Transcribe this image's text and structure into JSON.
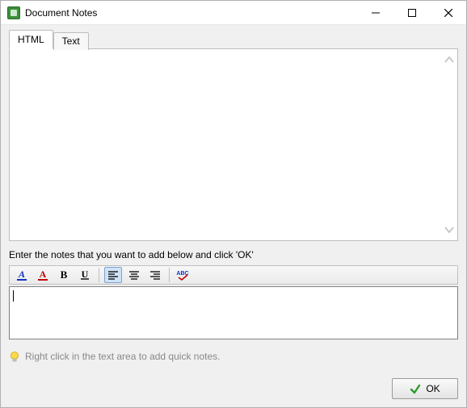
{
  "window": {
    "title": "Document Notes"
  },
  "tabs": {
    "html": "HTML",
    "text": "Text",
    "active": "html"
  },
  "notes_view": {
    "content": ""
  },
  "prompt": "Enter the notes that you want to add below and click 'OK'",
  "editor": {
    "value": ""
  },
  "hint": "Right click in the text area to add quick notes.",
  "buttons": {
    "ok": "OK"
  },
  "toolbar": {
    "underline_a": "A",
    "color_a": "A",
    "bold": "B",
    "underline": "U",
    "align_left": "align-left",
    "align_center": "align-center",
    "align_right": "align-right",
    "spellcheck": "ABC"
  }
}
